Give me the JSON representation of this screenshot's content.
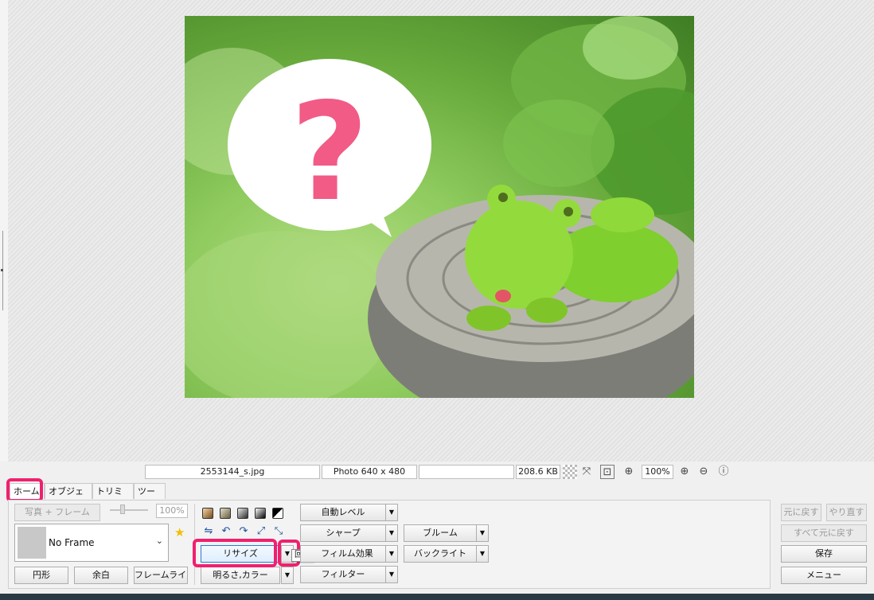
{
  "photo": {
    "question_mark": "?"
  },
  "statusbar": {
    "filename": "2553144_s.jpg",
    "dimensions": "Photo 640 x 480",
    "extra": "",
    "filesize": "208.6 KB",
    "zoom": "100%"
  },
  "tabs": [
    "ホーム",
    "オブジェクト",
    "トリミング",
    "ツール"
  ],
  "left_group": {
    "photo_frame_button": "写真 + フレーム",
    "opacity_value": "100%",
    "frame_select_value": "No Frame",
    "circle_button": "円形",
    "margin_button": "余白",
    "frameline_button": "フレームライン"
  },
  "middle_group": {
    "resize_button": "リサイズ",
    "brightness_button": "明るさ,カラー",
    "tooltip": "回転"
  },
  "effects_group": {
    "auto_level": "自動レベル",
    "sharp": "シャープ",
    "film_effect": "フィルム効果",
    "filter": "フィルター",
    "bloom": "ブルーム",
    "backlight": "バックライト"
  },
  "right_group": {
    "undo": "元に戻す",
    "redo": "やり直す",
    "revert_all": "すべて元に戻す",
    "save": "保存",
    "menu": "メニュー"
  },
  "colors": {
    "highlight": "#f0206e",
    "question_mark": "#f15b86",
    "accent": "#2e7ad1"
  }
}
